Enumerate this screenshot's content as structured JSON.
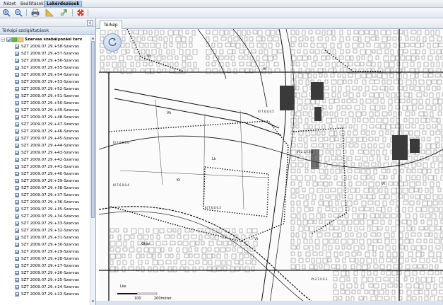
{
  "menu": {
    "tabs": [
      {
        "label": "Nézet",
        "active": false
      },
      {
        "label": "Beállítások",
        "active": false
      },
      {
        "label": "Lekérdezések",
        "active": true
      }
    ]
  },
  "toolbar": {
    "buttons": [
      "zoom-in-icon",
      "zoom-out-icon",
      "print-icon",
      "measure-icon",
      "pan-icon",
      "help-icon"
    ]
  },
  "left_panel": {
    "title": "Térképi szolgáltatások",
    "root_item": "Szarvas szabályozási terv",
    "layers": [
      "SZT 2009.07.29.+58-Szarvas",
      "SZT 2009.07.29.+57-Szarvas",
      "SZT 2009.07.29.+56-Szarvas",
      "SZT 2009.07.29.+55-Szarvas",
      "SZT 2009.07.29.+54-Szarvas",
      "SZT 2009.07.29.+53-Szarvas",
      "SZT 2009.07.29.+52-Szarvas",
      "SZT 2009.07.29.+51-Szarvas",
      "SZT 2009.07.29.+50-Szarvas",
      "SZT 2009.07.29.+49-Szarvas",
      "SZT 2009.07.29.+48-Szarvas",
      "SZT 2009.07.29.+47-Szarvas",
      "SZT 2009.07.29.+46-Szarvas",
      "SZT 2009.07.29.+45-Szarvas",
      "SZT 2009.07.29.+44-Szarvas",
      "SZT 2009.07.29.+43-Szarvas",
      "SZT 2009.07.29.+42-Szarvas",
      "SZT 2009.07.29.+41-Szarvas",
      "SZT 2009.07.29.+40-Szarvas",
      "SZT 2009.07.29.+39-Szarvas",
      "SZT 2009.07.29.+38-Szarvas",
      "SZT 2009.07.29.+37-Szarvas",
      "SZT 2009.07.29.+36-Szarvas",
      "SZT 2009.07.29.+35-Szarvas",
      "SZT 2009.07.29.+34-Szarvas",
      "SZT 2009.07.29.+33-Szarvas",
      "SZT 2009.07.29.+32-Szarvas",
      "SZT 2009.07.29.+31-Szarvas",
      "SZT 2009.07.29.+30-Szarvas",
      "SZT 2009.07.29.+29-Szarvas",
      "SZT 2009.07.29.+28-Szarvas",
      "SZT 2009.07.29.+27-Szarvas",
      "SZT 2009.07.29.+26-Szarvas",
      "SZT 2009.07.29.+25-Szarvas",
      "SZT 2009.07.29.+24-Szarvas",
      "SZT 2009.07.29.+23-Szarvas"
    ]
  },
  "map": {
    "tab_label": "Térkép",
    "scale_labels": [
      "100",
      "200méter"
    ],
    "zone_labels": [
      "Vt",
      "Vt",
      "Lk",
      "Vt",
      "Vt",
      "Gksz",
      "Kt",
      "Vk",
      "Lke"
    ],
    "parcel_codes": [
      "Kl 7.6.0.0.6",
      "Kl 7.6.0.0.4",
      "Kl 7.6.0.0.3",
      "Kl 7.6.0.0.5",
      "Vt 2.1.0.0.6",
      "Vt 2.1.0.0.3"
    ]
  }
}
